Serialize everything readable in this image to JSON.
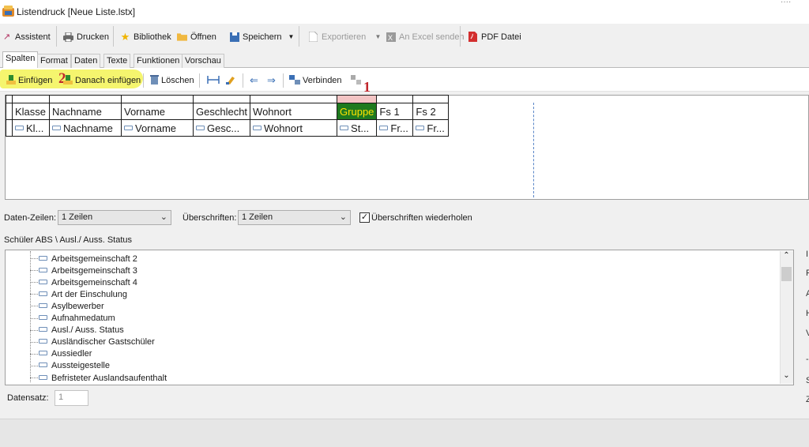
{
  "window": {
    "title": "Listendruck [Neue Liste.lstx]",
    "corner_glyphs": "····"
  },
  "toolbar": {
    "assistent": "Assistent",
    "drucken": "Drucken",
    "bibliothek": "Bibliothek",
    "oeffnen": "Öffnen",
    "speichern": "Speichern",
    "exportieren": "Exportieren",
    "excel": "An Excel senden",
    "pdf": "PDF Datei"
  },
  "tabs": [
    "Spalten",
    "Format",
    "Daten",
    "Texte",
    "Funktionen",
    "Vorschau"
  ],
  "subtoolbar": {
    "einfuegen": "Einfügen",
    "danach_einfuegen": "Danach einfügen",
    "loeschen": "Löschen",
    "verbinden": "Verbinden",
    "marker_1": "1",
    "marker_2": "2"
  },
  "columns": {
    "headers": [
      "Klasse",
      "Nachname",
      "Vorname",
      "Geschlecht",
      "Wohnort",
      "Gruppe",
      "Fs 1",
      "Fs 2"
    ],
    "fields": [
      "Kl...",
      "Nachname",
      "Vorname",
      "Gesc...",
      "Wohnort",
      "St...",
      "Fr...",
      "Fr..."
    ],
    "selected_column": "Gruppe"
  },
  "options": {
    "daten_zeilen_label": "Daten-Zeilen:",
    "daten_zeilen_value": "1 Zeilen",
    "ueberschriften_label": "Überschriften:",
    "ueberschriften_value": "1 Zeilen",
    "repeat_label": "Überschriften wiederholen",
    "repeat_checked": true
  },
  "tree": {
    "path": "Schüler ABS \\ Ausl./ Auss. Status",
    "items": [
      "Arbeitsgemeinschaft 2",
      "Arbeitsgemeinschaft 3",
      "Arbeitsgemeinschaft 4",
      "Art der Einschulung",
      "Asylbewerber",
      "Aufnahmedatum",
      "Ausl./ Auss. Status",
      "Ausländischer Gastschüler",
      "Aussiedler",
      "Aussteigestelle",
      "Befristeter Auslandsaufenthalt"
    ]
  },
  "right_edge_letters": [
    "I",
    "F",
    "A",
    "H",
    "V",
    "-",
    "S",
    "Z"
  ],
  "datensatz": {
    "label": "Datensatz:",
    "value": "1"
  },
  "colors": {
    "highlight": "#f5f56e",
    "selected_column_bg": "#1f7a1f",
    "selected_column_text": "#ffe100",
    "marker_red": "#c0262c"
  }
}
